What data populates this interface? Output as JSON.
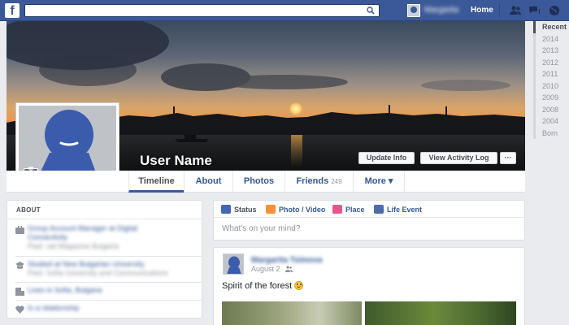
{
  "topbar": {
    "logo": "f",
    "search_placeholder": "",
    "user_name": "Margarita Tsimova",
    "home_label": "Home",
    "icons": [
      "friends-icon",
      "messages-icon",
      "notifications-globe-icon"
    ]
  },
  "colors": {
    "brand": "#3b5998",
    "link": "#365899",
    "background": "#e9ebee"
  },
  "cover": {
    "user_name": "User Name",
    "update_info_label": "Update Info",
    "activity_log_label": "View Activity Log",
    "more_label": "···"
  },
  "nav": {
    "timeline": "Timeline",
    "about": "About",
    "photos": "Photos",
    "friends": "Friends",
    "friends_count": "249",
    "more": "More ▾"
  },
  "years": [
    "Recent",
    "2014",
    "2013",
    "2012",
    "2011",
    "2010",
    "2009",
    "2008",
    "2004",
    "Born"
  ],
  "about": {
    "title": "ABOUT",
    "rows": [
      {
        "icon": "work-icon",
        "line1": "Group Account Manager at Digital",
        "line2": "Connectivity",
        "line3": "Past: sat Magazine Bulgaria"
      },
      {
        "icon": "school-icon",
        "line1": "Studied at New Bulgarian University",
        "line2": "Past: Sofia University and Communications"
      },
      {
        "icon": "home-icon",
        "line1": "Lives in Sofia, Bulgaria"
      },
      {
        "icon": "heart-icon",
        "line1": "In a relationship"
      }
    ]
  },
  "composer": {
    "tabs": [
      "Status",
      "Photo / Video",
      "Place",
      "Life Event"
    ],
    "placeholder": "What's on your mind?"
  },
  "post": {
    "author": "Margarita Tsimova",
    "date": "August 2",
    "text": "Spirit of the forest"
  }
}
